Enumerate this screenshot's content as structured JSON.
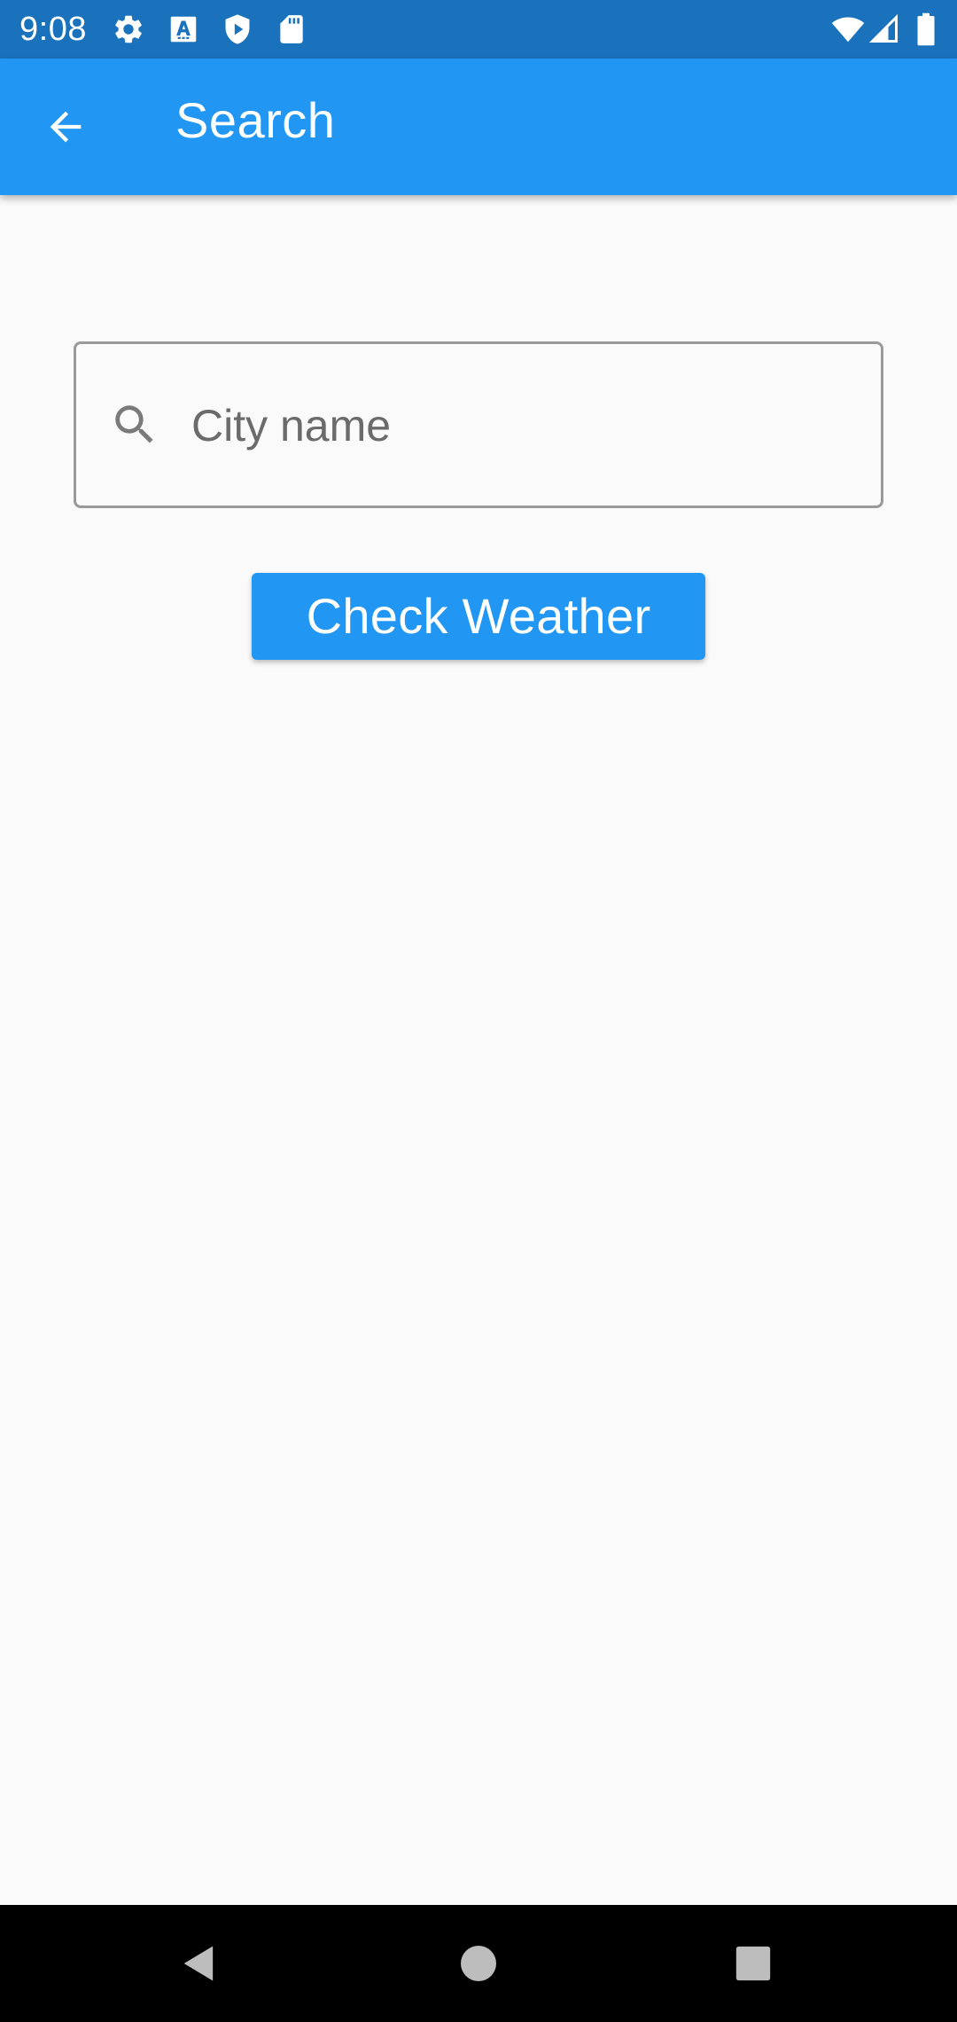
{
  "status_bar": {
    "time": "9:08",
    "left_icons": [
      "settings-icon",
      "font-a-icon",
      "shield-play-icon",
      "sd-card-icon"
    ],
    "right_icons": [
      "wifi-icon",
      "signal-icon",
      "battery-icon"
    ]
  },
  "app_bar": {
    "title": "Search",
    "back_icon": "arrow-back-icon"
  },
  "search": {
    "placeholder": "City name",
    "value": "",
    "icon": "search-icon"
  },
  "actions": {
    "check_weather_label": "Check Weather"
  },
  "nav_bar": {
    "buttons": [
      "back-triangle-icon",
      "home-circle-icon",
      "recents-square-icon"
    ]
  },
  "colors": {
    "status_bar": "#1a72bc",
    "app_bar": "#2196f3",
    "button": "#2196f3",
    "background": "#fafafa",
    "nav_bar": "#000000"
  }
}
